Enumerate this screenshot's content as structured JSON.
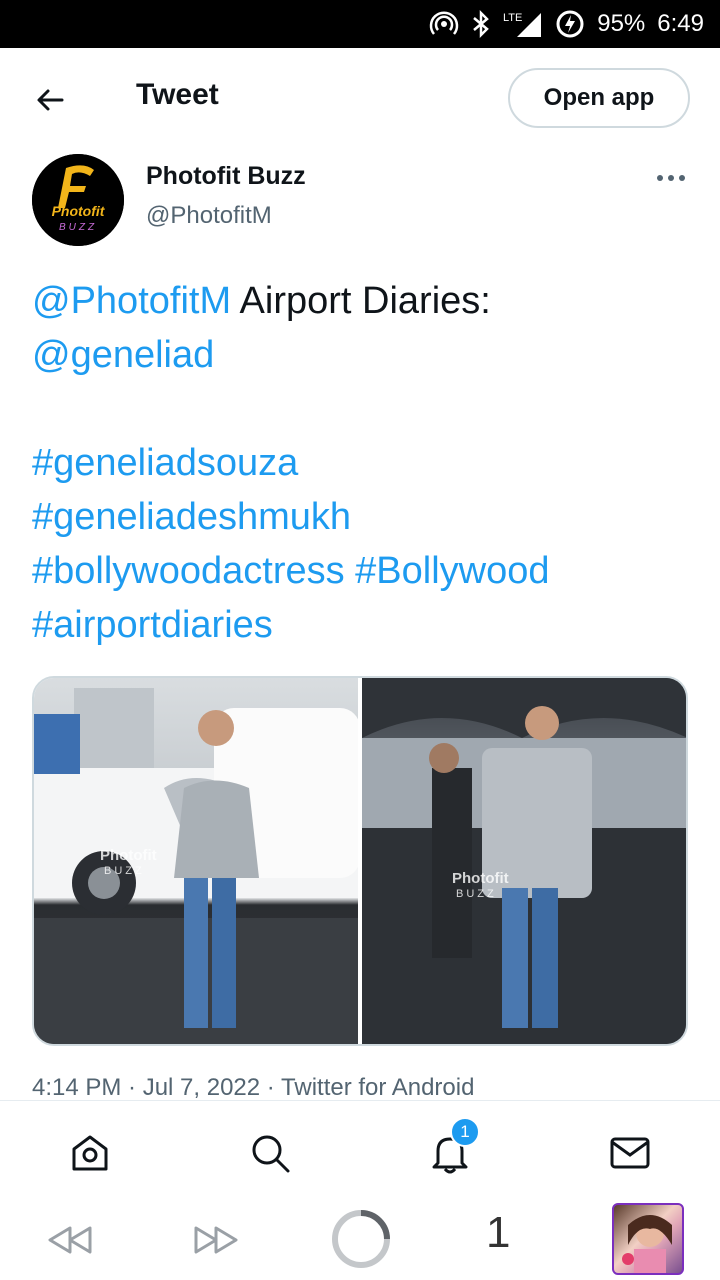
{
  "status_bar": {
    "battery": "95%",
    "time": "6:49",
    "network": "LTE"
  },
  "header": {
    "title": "Tweet",
    "open_app_label": "Open app"
  },
  "tweet": {
    "author_name": "Photofit Buzz",
    "author_handle": "@PhotofitM",
    "avatar_logo_text": "Photofit",
    "avatar_logo_sub": "BUZZ",
    "text_mention1": "@PhotofitM",
    "text_plain": " Airport Diaries:",
    "text_mention2": "@geneliad",
    "hashtags": [
      "#geneliadsouza",
      "#geneliadeshmukh",
      "#bollywoodactress",
      "#Bollywood",
      "#airportdiaries"
    ],
    "meta": "4:14 PM · Jul 7, 2022 · Twitter for Android",
    "photo_watermark_main": "Photofit",
    "photo_watermark_sub": "BUZZ"
  },
  "bottom_nav": {
    "notification_count": "1"
  },
  "browser_bar": {
    "tab_count": "1"
  },
  "colors": {
    "link": "#1d9bf0",
    "text": "#0f1419",
    "secondary": "#536471"
  }
}
